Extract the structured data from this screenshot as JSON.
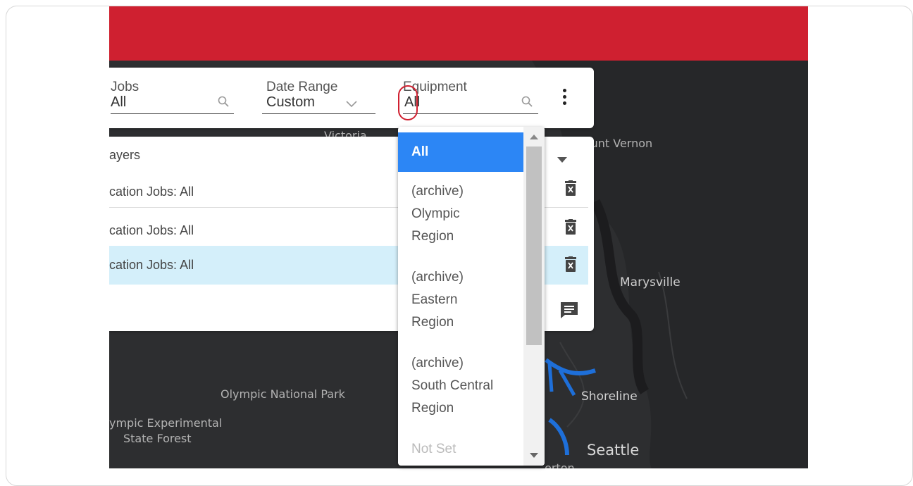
{
  "filters": {
    "jobs": {
      "label": "Jobs",
      "value": "All"
    },
    "date_range": {
      "label": "Date Range",
      "value": "Custom"
    },
    "equipment": {
      "label": "Equipment",
      "value": "All"
    }
  },
  "layers": {
    "header": "ayers",
    "rows": [
      {
        "label": "cation Jobs: All",
        "selected": false
      },
      {
        "label": "cation Jobs: All",
        "selected": false
      },
      {
        "label": "cation Jobs: All",
        "selected": true
      }
    ]
  },
  "equipment_dropdown": {
    "options": [
      {
        "label": "All",
        "selected": true
      },
      {
        "lines": [
          "(archive)",
          "Olympic",
          "Region"
        ]
      },
      {
        "lines": [
          "(archive)",
          "Eastern",
          "Region"
        ]
      },
      {
        "lines": [
          "(archive)",
          "South Central",
          "Region"
        ]
      },
      {
        "label": "Not Set",
        "dimmed": true
      }
    ]
  },
  "map_labels": {
    "victoria": "Victoria",
    "mount_vernon": "Mount Vernon",
    "marysville": "Marysville",
    "olympic_park": "Olympic National Park",
    "olympic_forest_1": "ympic Experimental",
    "olympic_forest_2": "State Forest",
    "shoreline": "Shoreline",
    "seattle": "Seattle",
    "bremerton": "erton"
  },
  "colors": {
    "header_red": "#cf2030",
    "selection_blue": "#2c86f5",
    "row_highlight": "#d4effa",
    "map_bg": "#2d2e30",
    "route_blue": "#1e6fd9"
  },
  "icons": [
    "search-icon",
    "chevron-down-icon",
    "kebab-menu-icon",
    "trash-icon",
    "comment-icon",
    "caret-down-icon"
  ]
}
